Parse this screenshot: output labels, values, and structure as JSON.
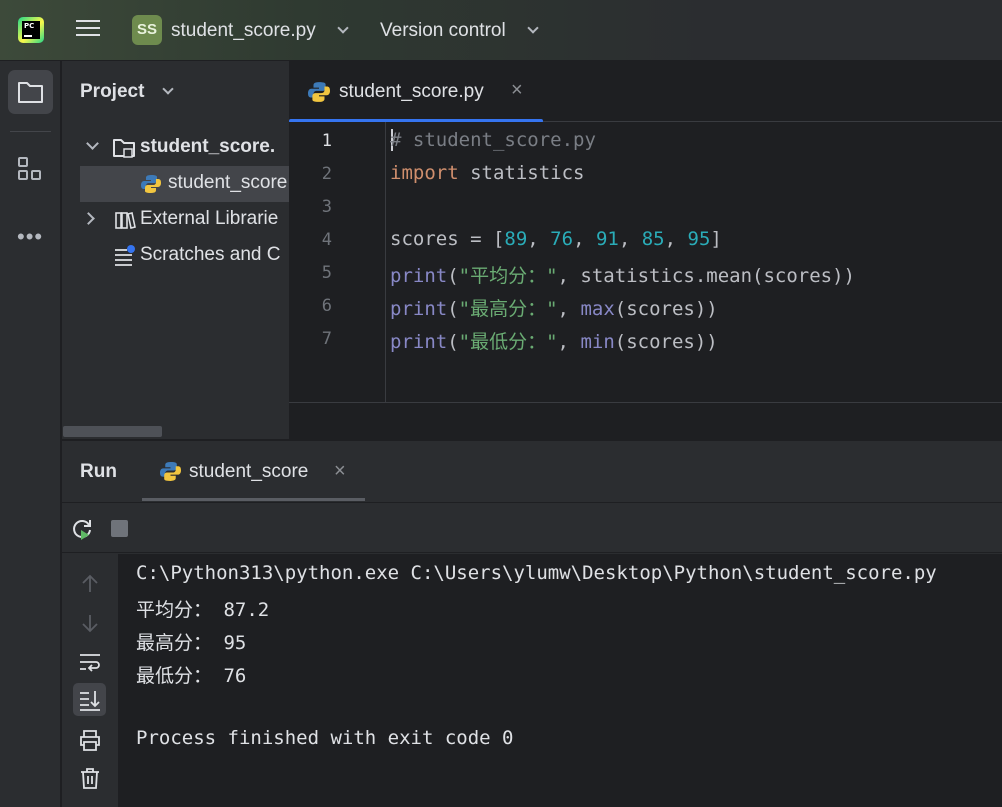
{
  "titlebar": {
    "project_badge": "SS",
    "project_name": "student_score.py",
    "version_control": "Version control",
    "logo_text": "PC"
  },
  "project_panel": {
    "title": "Project",
    "tree": [
      {
        "label": "student_score.",
        "type": "root-folder",
        "expanded": true
      },
      {
        "label": "student_score",
        "type": "python-file",
        "selected": true
      },
      {
        "label": "External Librarie",
        "type": "libraries",
        "expanded": false
      },
      {
        "label": "Scratches and C",
        "type": "scratches"
      }
    ]
  },
  "editor": {
    "tab": {
      "label": "student_score.py",
      "close": "×"
    },
    "line_numbers": [
      "1",
      "2",
      "3",
      "4",
      "5",
      "6",
      "7"
    ]
  },
  "run_panel": {
    "title": "Run",
    "tab": {
      "label": "student_score",
      "close": "×"
    },
    "console": [
      "C:\\Python313\\python.exe C:\\Users\\ylumw\\Desktop\\Python\\student_score.py",
      "平均分： 87.2",
      "最高分： 95",
      "最低分： 76",
      "",
      "Process finished with exit code 0"
    ]
  },
  "colors": {
    "accent": "#3574f0",
    "keyword": "#cf8e6d",
    "number": "#2aacb8",
    "string": "#6aab73",
    "builtin": "#8888c6",
    "comment": "#7a7e85"
  }
}
